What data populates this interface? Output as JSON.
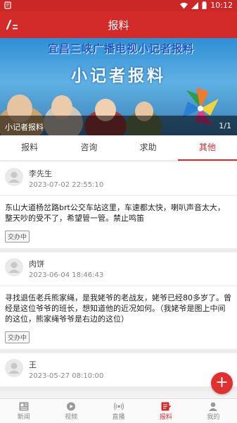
{
  "statusbar": {
    "time": "10:12"
  },
  "appbar": {
    "title": "报料"
  },
  "banner": {
    "headline": "宜昌三峡广播电视小记者报料",
    "big_text": "小记者报料",
    "caption": "小记者报料",
    "counter": "1/1"
  },
  "tabs": [
    {
      "label": "报料"
    },
    {
      "label": "咨询"
    },
    {
      "label": "求助"
    },
    {
      "label": "其他"
    }
  ],
  "posts": [
    {
      "name": "李先生",
      "time": "2023-07-02 22:55:10",
      "content": "东山大道杨岔路brt公交车站这里，车速都太快，喇叭声音太大，整天吵的受不了，希望管一管。禁止鸣笛",
      "status": "交办中"
    },
    {
      "name": "肉饼",
      "time": "2023-06-04 18:46:43",
      "content": "寻找退伍老兵熊家绳，是我姥爷的老战友，姥爷已经80多岁了。曾经是这位爷爷的班长，想知道他的近况如何。（我姥爷是图上中间的这位，熊家绳爷爷是右边的这位）",
      "status": "交办中"
    },
    {
      "name": "王",
      "time": "2023-05-27 08:10:00",
      "content": "",
      "status": ""
    }
  ],
  "fab": {
    "label": "+"
  },
  "bottomnav": [
    {
      "label": "新闻",
      "icon": "news-icon"
    },
    {
      "label": "视频",
      "icon": "video-icon"
    },
    {
      "label": "直播",
      "icon": "live-icon"
    },
    {
      "label": "报料",
      "icon": "report-icon"
    },
    {
      "label": "我的",
      "icon": "profile-icon"
    }
  ],
  "colors": {
    "brand": "#d32a2a",
    "text": "#222222",
    "muted": "#888888"
  }
}
